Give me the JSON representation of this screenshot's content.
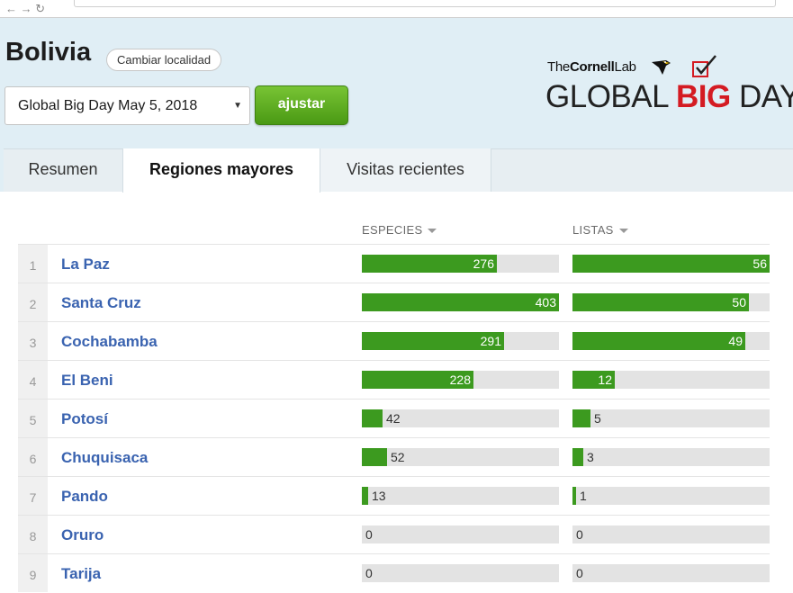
{
  "browser": {
    "nav_glyphs": "← → ↻"
  },
  "header": {
    "country": "Bolivia",
    "change_locality": "Cambiar localidad",
    "event_selected": "Global Big Day May 5, 2018",
    "adjust_label": "ajustar",
    "logo_lab_the": "The",
    "logo_lab_cornell": "Cornell",
    "logo_lab_lab": "Lab",
    "logo_global": "GLOBAL ",
    "logo_big": "BIG",
    "logo_day": " DAY"
  },
  "tabs": [
    {
      "label": "Resumen"
    },
    {
      "label": "Regiones mayores",
      "active": true
    },
    {
      "label": "Visitas recientes"
    }
  ],
  "table": {
    "col_species": "ESPECIES",
    "col_lists": "LISTAS",
    "max_species": 403,
    "max_lists": 56,
    "rows": [
      {
        "rank": "1",
        "name": "La Paz",
        "species": 276,
        "lists": 56
      },
      {
        "rank": "2",
        "name": "Santa Cruz",
        "species": 403,
        "lists": 50
      },
      {
        "rank": "3",
        "name": "Cochabamba",
        "species": 291,
        "lists": 49
      },
      {
        "rank": "4",
        "name": "El Beni",
        "species": 228,
        "lists": 12
      },
      {
        "rank": "5",
        "name": "Potosí",
        "species": 42,
        "lists": 5
      },
      {
        "rank": "6",
        "name": "Chuquisaca",
        "species": 52,
        "lists": 3
      },
      {
        "rank": "7",
        "name": "Pando",
        "species": 13,
        "lists": 1
      },
      {
        "rank": "8",
        "name": "Oruro",
        "species": 0,
        "lists": 0
      },
      {
        "rank": "9",
        "name": "Tarija",
        "species": 0,
        "lists": 0
      }
    ]
  },
  "colors": {
    "bar": "#3c9a1f",
    "track": "#e3e3e3",
    "link": "#3a63b0",
    "big_red": "#d41b22"
  }
}
